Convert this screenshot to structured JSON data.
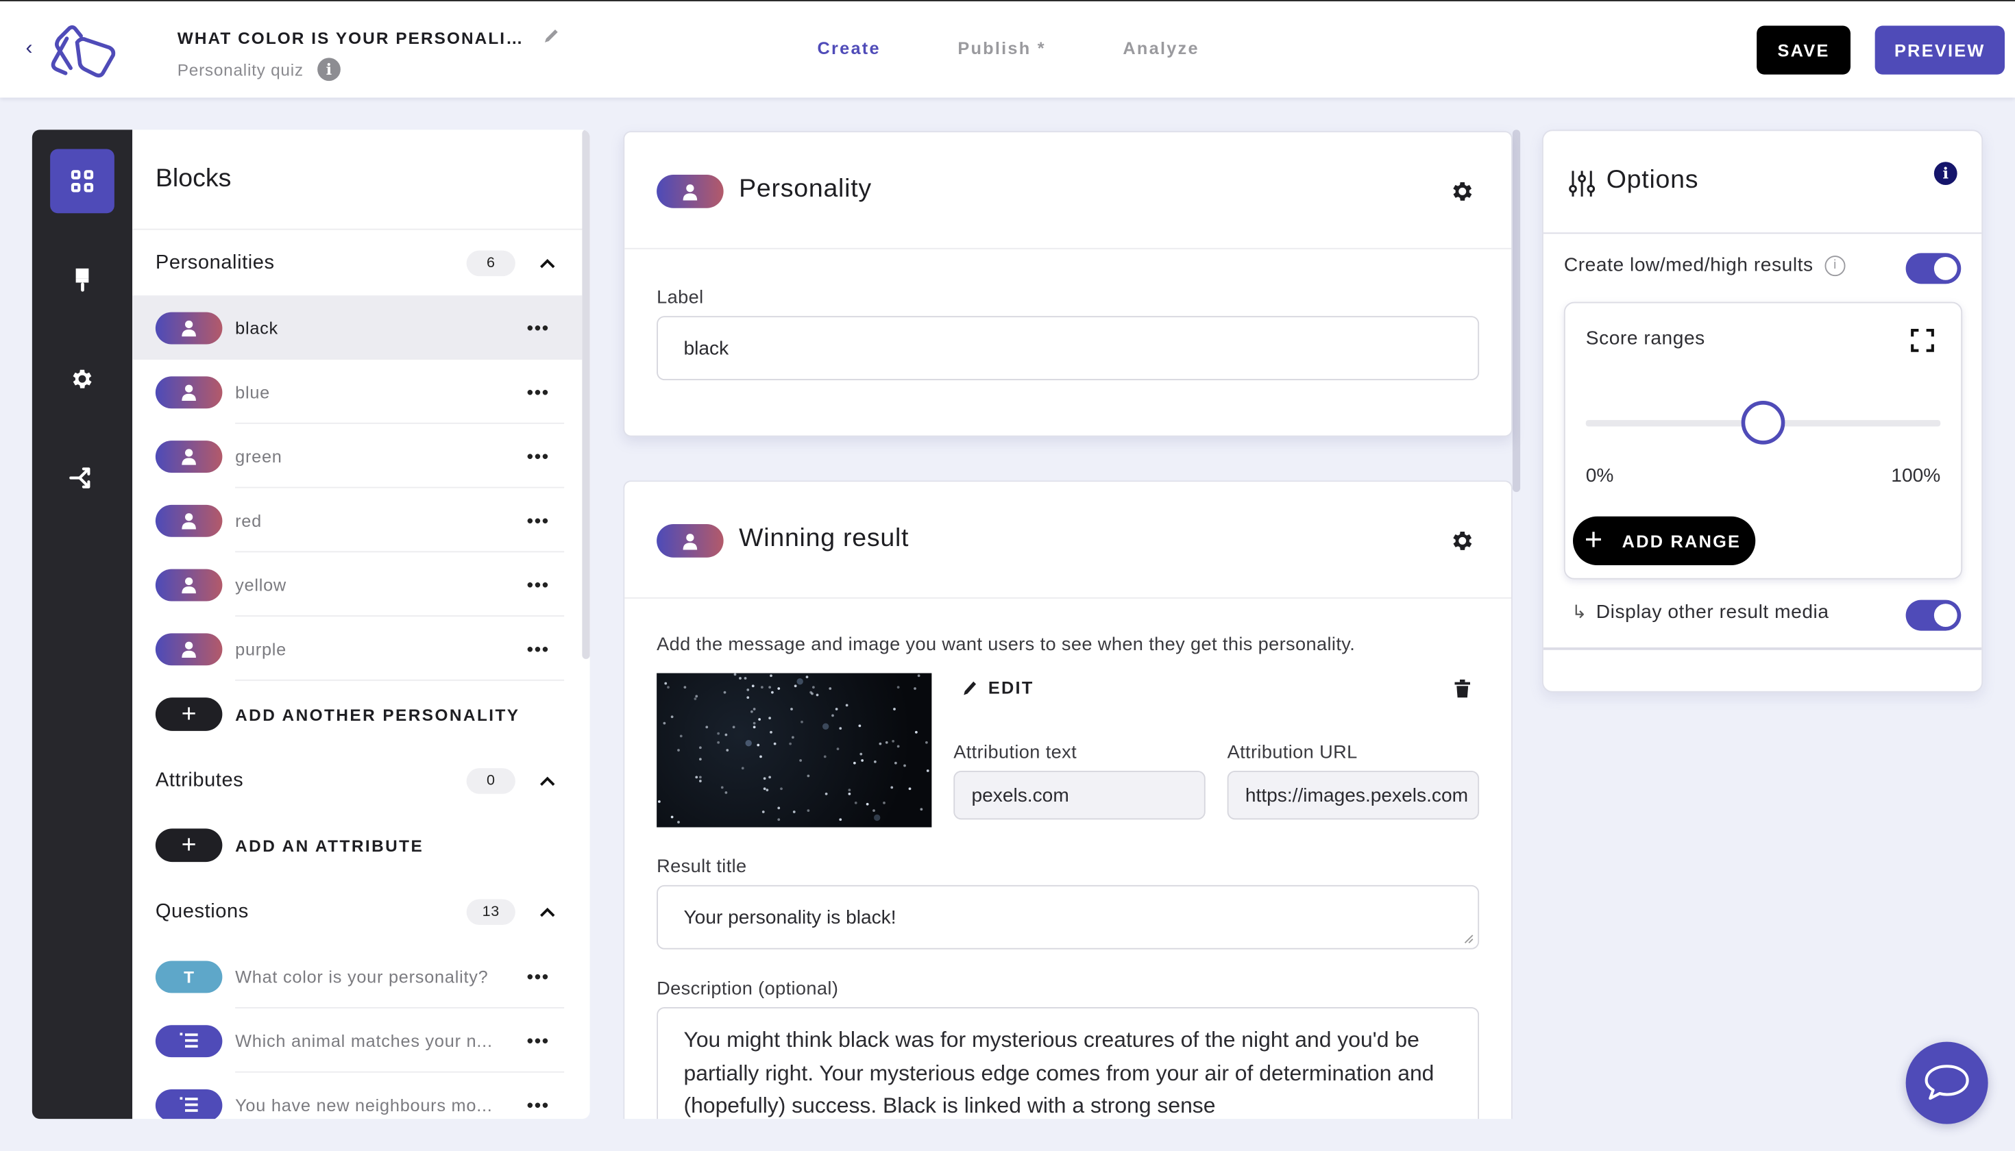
{
  "header": {
    "quiz_title": "WHAT COLOR IS YOUR PERSONALI…",
    "quiz_type": "Personality quiz",
    "back_icon": "chevron-left-icon",
    "tabs": [
      {
        "label": "Create",
        "active": true
      },
      {
        "label": "Publish *",
        "active": false
      },
      {
        "label": "Analyze",
        "active": false
      }
    ],
    "save_label": "SAVE",
    "preview_label": "PREVIEW"
  },
  "colors": {
    "accent": "#4f4bb8",
    "rail_bg": "#27272c",
    "page_bg": "#eef0f9",
    "question_text_pill": "#5ea7c9",
    "personality_gradient": [
      "#4d4bb8",
      "#b35a6a"
    ]
  },
  "rail": {
    "items": [
      {
        "icon": "grid-icon",
        "active": true
      },
      {
        "icon": "paint-brush-icon",
        "active": false
      },
      {
        "icon": "gear-icon",
        "active": false
      },
      {
        "icon": "branch-icon",
        "active": false
      }
    ]
  },
  "blocks": {
    "title": "Blocks",
    "personalities": {
      "label": "Personalities",
      "count": "6",
      "items": [
        {
          "label": "black",
          "selected": true
        },
        {
          "label": "blue",
          "selected": false
        },
        {
          "label": "green",
          "selected": false
        },
        {
          "label": "red",
          "selected": false
        },
        {
          "label": "yellow",
          "selected": false
        },
        {
          "label": "purple",
          "selected": false
        }
      ],
      "add_label": "ADD ANOTHER PERSONALITY"
    },
    "attributes": {
      "label": "Attributes",
      "count": "0",
      "add_label": "ADD AN ATTRIBUTE"
    },
    "questions": {
      "label": "Questions",
      "count": "13",
      "items": [
        {
          "type": "text",
          "type_glyph": "T",
          "label": "What color is your personality?"
        },
        {
          "type": "list",
          "type_glyph": "list",
          "label": "Which animal matches your n..."
        },
        {
          "type": "list",
          "type_glyph": "list",
          "label": "You have new neighbours mo..."
        }
      ]
    },
    "more_glyph": "•••"
  },
  "personality_card": {
    "title": "Personality",
    "label_field": {
      "label": "Label",
      "value": "black"
    }
  },
  "result_card": {
    "title": "Winning result",
    "helper": "Add the message and image you want users to see when they get this personality.",
    "edit_label": "EDIT",
    "attribution_text": {
      "label": "Attribution text",
      "value": "pexels.com"
    },
    "attribution_url": {
      "label": "Attribution URL",
      "value": "https://images.pexels.com"
    },
    "result_title": {
      "label": "Result title",
      "value": "Your personality is black!"
    },
    "description": {
      "label": "Description (optional)",
      "value": "You might think black was for mysterious creatures of the night and you'd be partially right. Your mysterious edge comes from your air of determination and (hopefully) success. Black is linked with a strong sense"
    }
  },
  "options": {
    "title": "Options",
    "low_med_high": {
      "label": "Create low/med/high results",
      "enabled": true
    },
    "score_ranges": {
      "title": "Score ranges",
      "min_label": "0%",
      "max_label": "100%",
      "thumb_value_percent": 50,
      "add_label": "ADD RANGE"
    },
    "display_media": {
      "label": "Display other result media",
      "enabled": true,
      "arrow": "↳"
    }
  }
}
